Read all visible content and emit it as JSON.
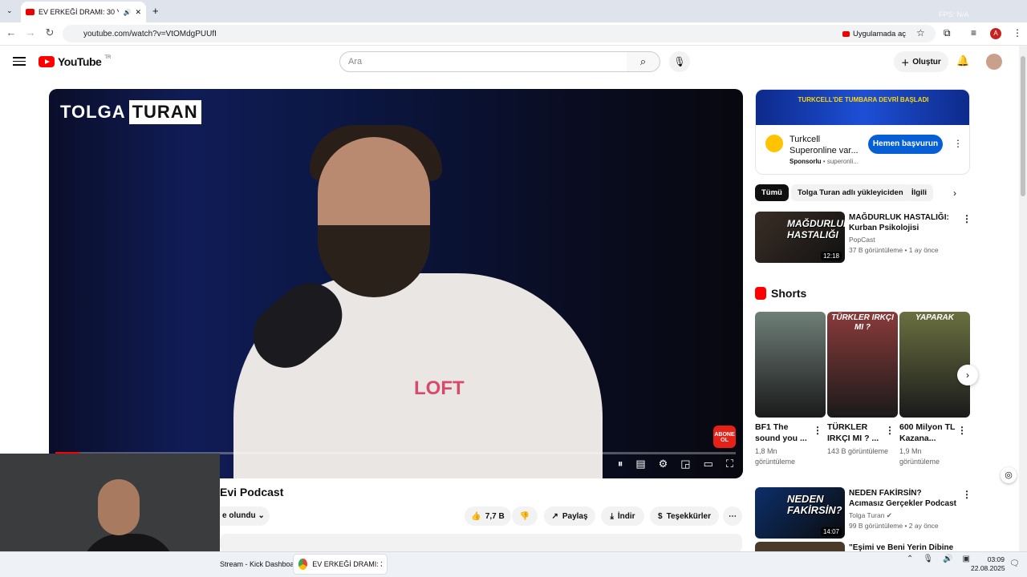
{
  "browser": {
    "tab_title": "EV ERKEĞİ DRAMI: 30 Yaşın",
    "url": "youtube.com/watch?v=VtOMdgPUUfI",
    "open_in_app": "Uygulamada aç",
    "profile_letter": "A",
    "fps_readout": "FPS: N/A"
  },
  "header": {
    "logo_text": "YouTube",
    "region": "TR",
    "search_placeholder": "Ara",
    "create_label": "Oluştur"
  },
  "video": {
    "channel_watermark_a": "TOLGA",
    "channel_watermark_b": "TURAN",
    "shirt_text": "LOFT",
    "subscribe_badge": "ABONE OL",
    "title_fragment": "Evi Podcast",
    "subscribed_label": "e olundu",
    "likes": "7,7 B",
    "share": "Paylaş",
    "download": "İndir",
    "thanks": "Teşekkürler"
  },
  "ad": {
    "banner_text": "TURKCELL'DE TUMBARA DEVRİ BAŞLADI",
    "title": "Turkcell Superonline var...",
    "sponsored": "Sponsorlu",
    "source": "superonli...",
    "cta": "Hemen başvurun"
  },
  "chips": [
    "Tümü",
    "Tolga Turan adlı yükleyiciden",
    "İlgili"
  ],
  "recs": [
    {
      "thumb": "MAĞDURLUK HASTALIĞI",
      "duration": "12:18",
      "title": "MAĞDURLUK HASTALIĞI: Kurban Psikolojisi",
      "channel": "PopCast",
      "meta": "37 B görüntüleme • 1 ay önce"
    },
    {
      "thumb": "NEDEN FAKİRSİN?",
      "duration": "14:07",
      "title": "NEDEN FAKİRSİN? Acımasız Gerçekler Podcast",
      "channel": "Tolga Turan",
      "meta": "99 B görüntüleme • 2 ay önce"
    },
    {
      "title": "\"Eşimi ve Beni Yerin Dibine"
    }
  ],
  "shorts": {
    "heading": "Shorts",
    "items": [
      {
        "caption": "",
        "title": "BF1 The sound you ...",
        "views": "1,8 Mn görüntüleme",
        "bg": "#6f7f78"
      },
      {
        "caption": "TÜRKLER IRKÇI MI ?",
        "title": "TÜRKLER IRKÇI MI ? ...",
        "views": "143 B görüntüleme",
        "bg": "#8a3a3a"
      },
      {
        "caption": "YAPARAK",
        "title": "600 Milyon TL Kazana...",
        "views": "1,9 Mn görüntüleme",
        "bg": "#6b7040"
      }
    ]
  },
  "taskbar": {
    "item1": "Stream - Kick Dashboard",
    "item2": "EV ERKEĞİ DRAMI: 30 Ya",
    "time": "03:09",
    "date": "22.08.2025"
  }
}
